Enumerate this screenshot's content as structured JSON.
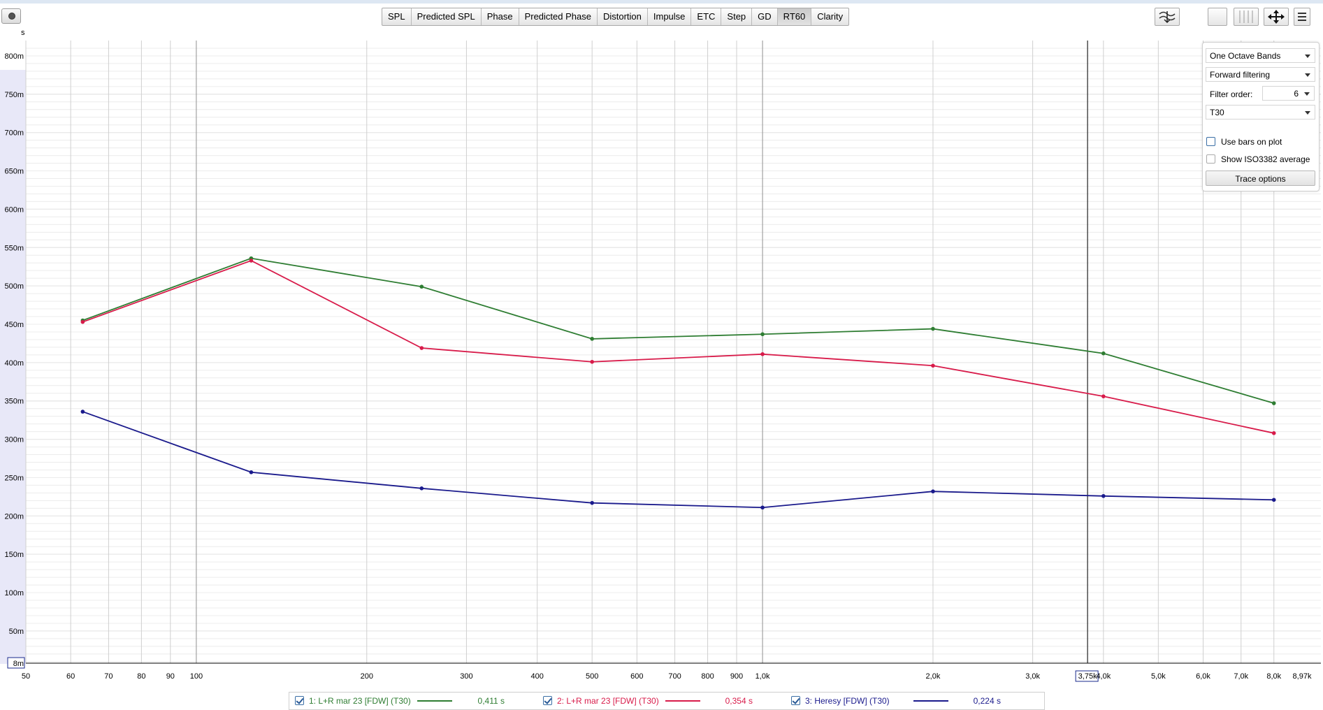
{
  "toolbar": {
    "tabs": [
      "SPL",
      "Predicted SPL",
      "Phase",
      "Predicted Phase",
      "Distortion",
      "Impulse",
      "ETC",
      "Step",
      "GD",
      "RT60",
      "Clarity"
    ],
    "active": "RT60"
  },
  "icons": [
    "camera-icon",
    "scale-icon",
    "single-view-icon",
    "grid-view-icon",
    "move-icon",
    "settings-icon"
  ],
  "panel": {
    "bands": "One Octave Bands",
    "filtering": "Forward filtering",
    "filter_order_label": "Filter order:",
    "filter_order_value": "6",
    "metric": "T30",
    "use_bars_label": "Use bars on plot",
    "iso_label": "Show ISO3382 average",
    "trace_options_label": "Trace options"
  },
  "legend": [
    {
      "name": "1: L+R mar 23 [FDW] (T30)",
      "value": "0,411 s",
      "color": "#2e7d32"
    },
    {
      "name": "2: L+R mar 23 [FDW] (T30)",
      "value": "0,354 s",
      "color": "#d81b4a"
    },
    {
      "name": "3: Heresy [FDW] (T30)",
      "value": "0,224 s",
      "color": "#1a1a8c"
    }
  ],
  "chart_data": {
    "type": "line",
    "ylabel": "s",
    "xscale": "log",
    "xlim": [
      50,
      8970
    ],
    "ylim": [
      0.008,
      0.82
    ],
    "grid": true,
    "x_ticks": [
      "50",
      "60",
      "70",
      "80",
      "90",
      "100",
      "200",
      "300",
      "400",
      "500",
      "600",
      "700",
      "800",
      "900",
      "1,0k",
      "2,0k",
      "3,0k",
      "3,75k",
      "4,0k",
      "5,0k",
      "6,0k",
      "7,0k",
      "8,0k",
      "8,97k"
    ],
    "y_ticks": [
      "8m",
      "50m",
      "100m",
      "150m",
      "200m",
      "250m",
      "300m",
      "350m",
      "400m",
      "450m",
      "500m",
      "550m",
      "600m",
      "650m",
      "700m",
      "750m",
      "800m"
    ],
    "cursor_x_label": "3,75k",
    "x": [
      63,
      125,
      250,
      500,
      1000,
      2000,
      4000,
      8000
    ],
    "series": [
      {
        "name": "1: L+R mar 23 [FDW] (T30)",
        "color": "#2e7d32",
        "values": [
          0.455,
          0.536,
          0.499,
          0.431,
          0.437,
          0.444,
          0.412,
          0.347
        ]
      },
      {
        "name": "2: L+R mar 23 [FDW] (T30)",
        "color": "#d81b4a",
        "values": [
          0.453,
          0.533,
          0.419,
          0.401,
          0.411,
          0.396,
          0.356,
          0.308
        ]
      },
      {
        "name": "3: Heresy [FDW] (T30)",
        "color": "#1a1a8c",
        "values": [
          0.336,
          0.257,
          0.236,
          0.217,
          0.211,
          0.232,
          0.226,
          0.221
        ]
      }
    ]
  }
}
